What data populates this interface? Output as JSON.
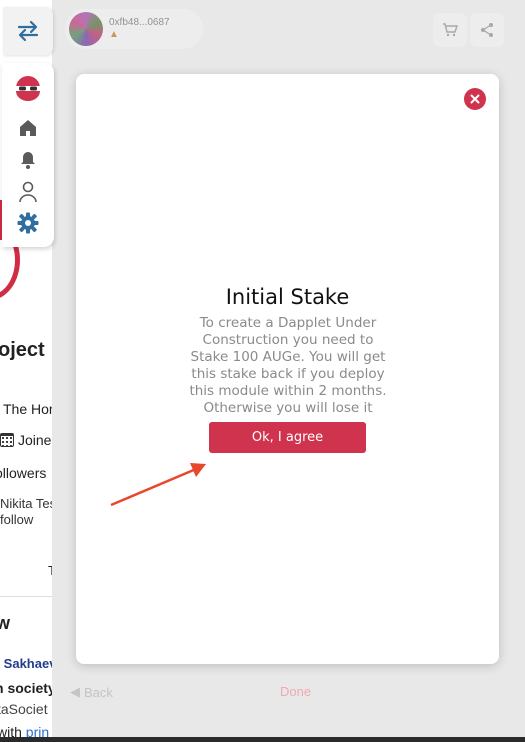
{
  "background_page": {
    "title_fragment": "oject",
    "the_fragment": "The Hor",
    "joined_fragment": "Joine",
    "followers_fragment": "ollowers",
    "nikita_line1": "Nikita Tes",
    "nikita_line2": "follow",
    "t_fragment": "T",
    "w_fragment": "w",
    "sakhaev_fragment": "r Sakhaev",
    "society_fragment": "n society",
    "ta_fragment": "taSociet",
    "with_fragment": "with ",
    "with_link": "prin"
  },
  "header": {
    "wallet_address": "0xfb48...0687",
    "wallet_icon": "metamask-fox-icon",
    "icons": [
      "cart-icon",
      "share-icon"
    ]
  },
  "toolbar": {
    "toggle_icon": "swap-arrows-icon",
    "items": [
      "dapplets-logo-icon",
      "home-icon",
      "bell-icon",
      "user-icon",
      "gear-icon"
    ],
    "accent": "#d0334d",
    "active_color": "#2f6f9f"
  },
  "modal": {
    "title": "Initial Stake",
    "body": "To create a Dapplet Under Construction you need to Stake 100 AUGe. You will get this stake back if you deploy this module within 2 months. Otherwise you will lose it",
    "confirm_label": "Ok, I agree",
    "close_icon": "close-icon",
    "accent": "#d0334d"
  },
  "footer": {
    "back_label": "Back",
    "done_label": "Done"
  },
  "annotation": {
    "arrow_color": "#e8472b"
  }
}
